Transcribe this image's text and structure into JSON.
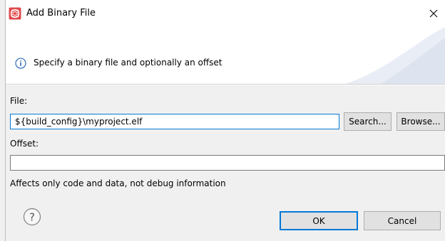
{
  "window": {
    "title": "Add Binary File"
  },
  "banner": {
    "message": "Specify a binary file and optionally an offset"
  },
  "file": {
    "label": "File:",
    "value": "${build_config}\\myproject.elf",
    "search_label": "Search...",
    "browse_label": "Browse..."
  },
  "offset": {
    "label": "Offset:",
    "value": ""
  },
  "note": "Affects only code and data, not debug information",
  "footer": {
    "ok_label": "OK",
    "cancel_label": "Cancel"
  },
  "icons": {
    "app": "app-icon",
    "info": "info-icon",
    "help": "help-icon",
    "close": "close-icon"
  },
  "colors": {
    "accent": "#0078d7",
    "app_icon": "#e0484b",
    "info_icon": "#1e5fb4",
    "dialog_bg": "#f0f0f0"
  }
}
